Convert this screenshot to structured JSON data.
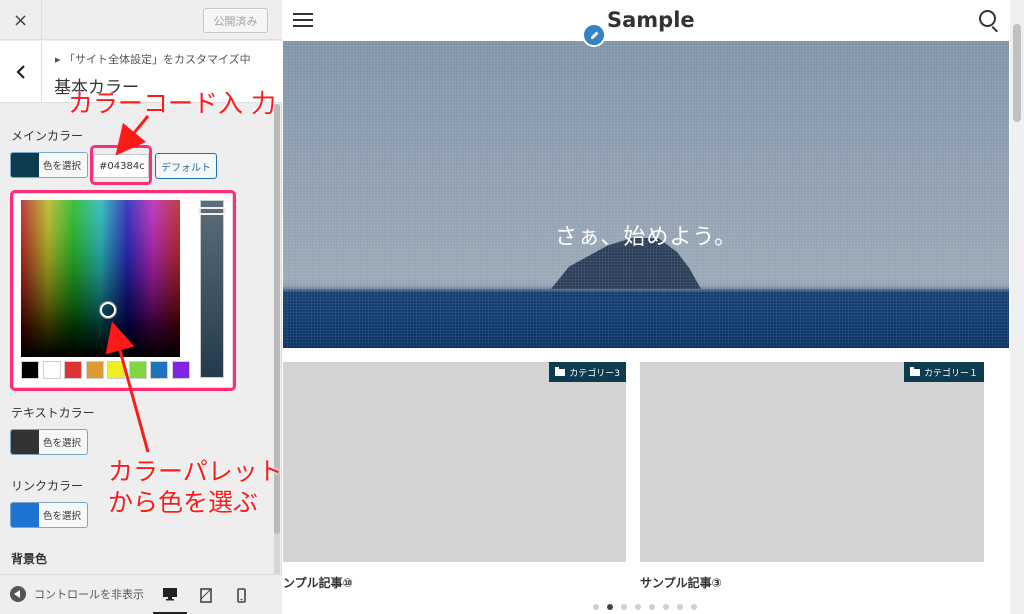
{
  "sidebar": {
    "close_icon": "×",
    "publish_label": "公開済み",
    "back_icon": "‹",
    "breadcrumb": "▸ 「サイト全体設定」をカスタマイズ中",
    "section_title": "基本カラー",
    "main_color": {
      "label": "メインカラー",
      "button_label": "色を選択",
      "swatch_color": "#0d3b4f",
      "hex_value": "#04384c",
      "default_label": "デフォルト"
    },
    "palette": [
      "#000000",
      "#ffffff",
      "#dd3333",
      "#dd9933",
      "#eeee22",
      "#81d742",
      "#1e73be",
      "#8224e3"
    ],
    "text_color": {
      "label": "テキストカラー",
      "button_label": "色を選択",
      "swatch_color": "#333333"
    },
    "link_color": {
      "label": "リンクカラー",
      "button_label": "色を選択",
      "swatch_color": "#1e73d2"
    },
    "bg_color": {
      "label": "背景色"
    },
    "footer": {
      "hide_controls_label": "コントロールを非表示"
    }
  },
  "annotations": {
    "color_code": "カラーコード入 力",
    "palette_line1": "カラーパレット",
    "palette_line2": "から色を選ぶ"
  },
  "preview": {
    "site_title": "Sample",
    "hero_text": "さぁ、始めよう。",
    "cards": [
      {
        "category": "カテゴリー3",
        "title": "ンプル記事⑩"
      },
      {
        "category": "カテゴリー１",
        "title": "サンプル記事③"
      }
    ],
    "slider_dots_count": 8,
    "slider_active_dot": 1
  },
  "colors": {
    "annotation_red": "#ff1a1a",
    "highlight_pink": "#ff2d78",
    "badge_bg": "#0d3b4f",
    "edit_shortcut_blue": "#3582c4"
  }
}
